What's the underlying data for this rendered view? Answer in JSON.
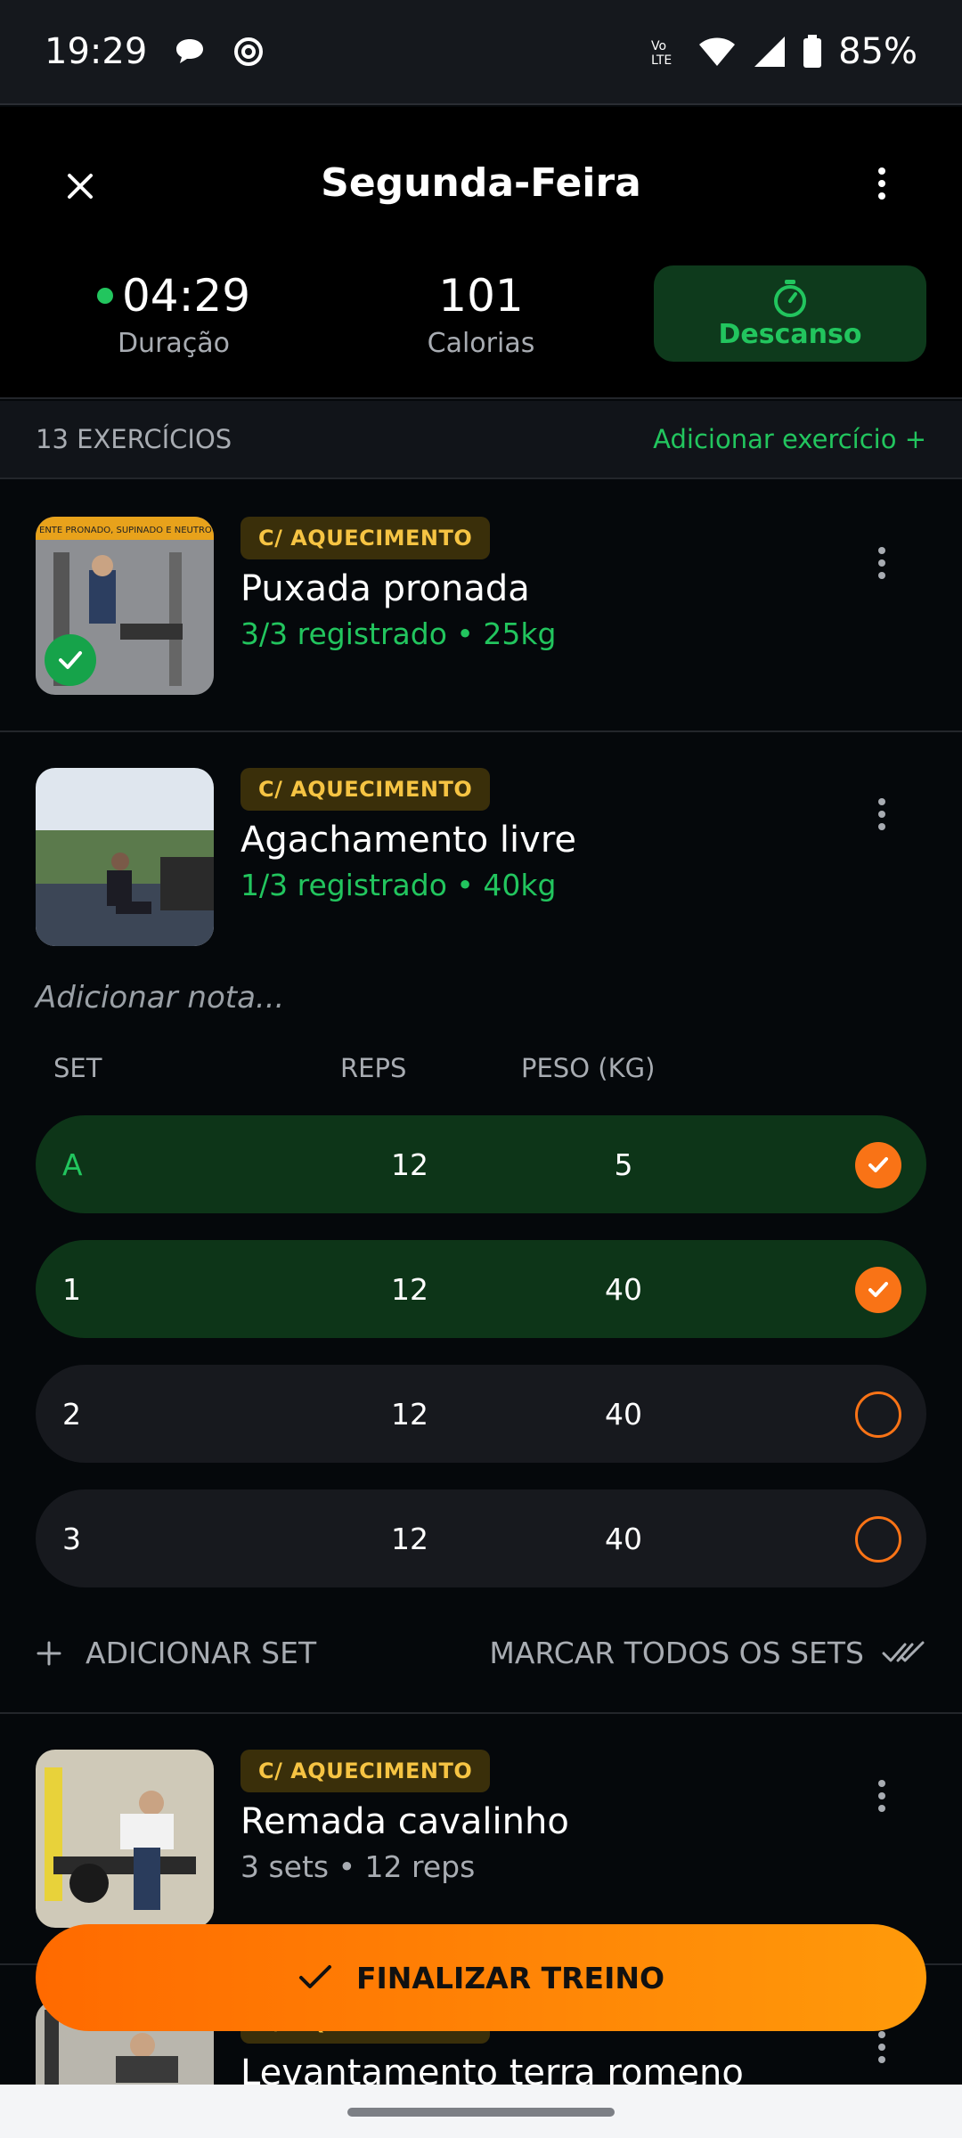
{
  "status_bar": {
    "time": "19:29",
    "battery": "85%"
  },
  "header": {
    "title": "Segunda-Feira",
    "duration_value": "04:29",
    "duration_label": "Duração",
    "calories_value": "101",
    "calories_label": "Calorias",
    "rest_label": "Descanso"
  },
  "exercise_bar": {
    "count": "13 EXERCÍCIOS",
    "add_label": "Adicionar exercício +"
  },
  "exercises": [
    {
      "tag": "C/ AQUECIMENTO",
      "name": "Puxada pronada",
      "progress": "3/3 registrado",
      "detail": "• 25kg",
      "thumb_caption": "ENTE PRONADO, SUPINADO E NEUTRO"
    },
    {
      "tag": "C/ AQUECIMENTO",
      "name": "Agachamento livre",
      "progress": "1/3 registrado",
      "detail": "• 40kg"
    },
    {
      "tag": "C/ AQUECIMENTO",
      "name": "Remada cavalinho",
      "summary": "3 sets • 12 reps"
    },
    {
      "tag": "C/ AQUECIMENTO",
      "name": "Levantamento terra romeno"
    }
  ],
  "notes": {
    "placeholder": "Adicionar nota..."
  },
  "columns": {
    "set": "SET",
    "reps": "REPS",
    "peso": "PESO (KG)"
  },
  "sets": [
    {
      "set": "A",
      "reps": "12",
      "peso": "5",
      "checked": true
    },
    {
      "set": "1",
      "reps": "12",
      "peso": "40",
      "checked": true
    },
    {
      "set": "2",
      "reps": "12",
      "peso": "40",
      "checked": false
    },
    {
      "set": "3",
      "reps": "12",
      "peso": "40",
      "checked": false
    }
  ],
  "actions": {
    "add_set": "ADICIONAR SET",
    "mark_all": "MARCAR TODOS OS SETS"
  },
  "finish": {
    "label": "FINALIZAR TREINO"
  },
  "colors": {
    "accent_green": "#22c55e",
    "accent_orange": "#f97316",
    "tag_yellow": "#f6c443"
  }
}
